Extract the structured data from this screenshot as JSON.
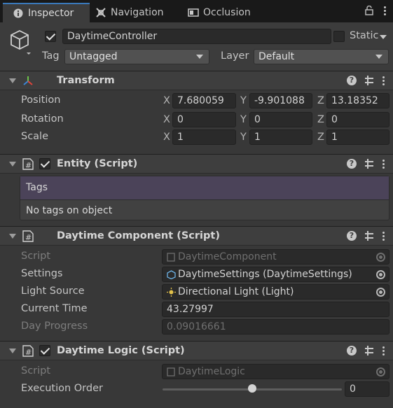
{
  "tabs": [
    {
      "label": "Inspector",
      "icon": "info-icon",
      "active": true
    },
    {
      "label": "Navigation",
      "icon": "navigation-icon",
      "active": false
    },
    {
      "label": "Occlusion",
      "icon": "occlusion-icon",
      "active": false
    }
  ],
  "object": {
    "active": true,
    "name": "DaytimeController",
    "static_label": "Static",
    "static_checked": false,
    "tag_label": "Tag",
    "tag_value": "Untagged",
    "layer_label": "Layer",
    "layer_value": "Default"
  },
  "transform": {
    "title": "Transform",
    "position_label": "Position",
    "rotation_label": "Rotation",
    "scale_label": "Scale",
    "axes": [
      "X",
      "Y",
      "Z"
    ],
    "position": [
      "7.680059",
      "-9.901088",
      "13.18352"
    ],
    "rotation": [
      "0",
      "0",
      "0"
    ],
    "scale": [
      "1",
      "1",
      "1"
    ]
  },
  "entity": {
    "title": "Entity (Script)",
    "enabled": true,
    "tags_header": "Tags",
    "tags_empty": "No tags on object"
  },
  "daytime_component": {
    "title": "Daytime Component (Script)",
    "script_label": "Script",
    "script_value": "DaytimeComponent",
    "settings_label": "Settings",
    "settings_value": "DaytimeSettings (DaytimeSettings)",
    "light_label": "Light Source",
    "light_value": "Directional Light (Light)",
    "time_label": "Current Time",
    "time_value": "43.27997",
    "progress_label": "Day Progress",
    "progress_value": "0.09016661"
  },
  "daytime_logic": {
    "title": "Daytime Logic (Script)",
    "enabled": true,
    "script_label": "Script",
    "script_value": "DaytimeLogic",
    "order_label": "Execution Order",
    "order_value": "0",
    "order_slider_fraction": 0.5
  },
  "colors": {
    "accent": "#3a79bb",
    "tags_header_bg": "#4b4359"
  }
}
